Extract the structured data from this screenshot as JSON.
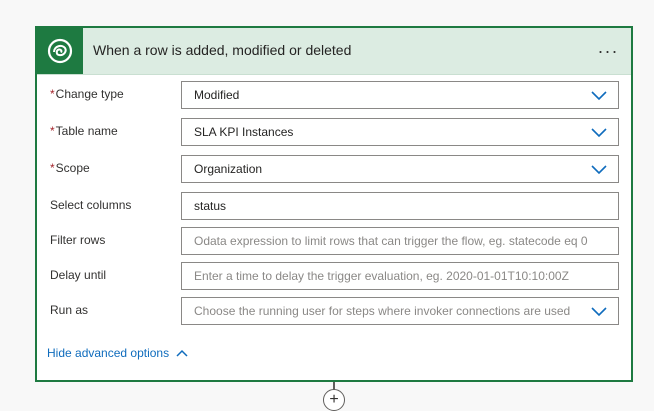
{
  "trigger": {
    "title": "When a row is added, modified or deleted",
    "more_label": "...",
    "logo_icon": "dataverse-icon",
    "accent_color": "#1e7a41"
  },
  "fields": {
    "change_type": {
      "label": "Change type",
      "required_mark": "*",
      "value": "Modified"
    },
    "table_name": {
      "label": "Table name",
      "required_mark": "*",
      "value": "SLA KPI Instances"
    },
    "scope": {
      "label": "Scope",
      "required_mark": "*",
      "value": "Organization"
    },
    "select_columns": {
      "label": "Select columns",
      "value": "status"
    },
    "filter_rows": {
      "label": "Filter rows",
      "placeholder": "Odata expression to limit rows that can trigger the flow, eg. statecode eq 0"
    },
    "delay_until": {
      "label": "Delay until",
      "placeholder": "Enter a time to delay the trigger evaluation, eg. 2020-01-01T10:10:00Z"
    },
    "run_as": {
      "label": "Run as",
      "placeholder": "Choose the running user for steps where invoker connections are used"
    }
  },
  "footer": {
    "hide_advanced_label": "Hide advanced options"
  },
  "add_step": {
    "label": "+"
  }
}
